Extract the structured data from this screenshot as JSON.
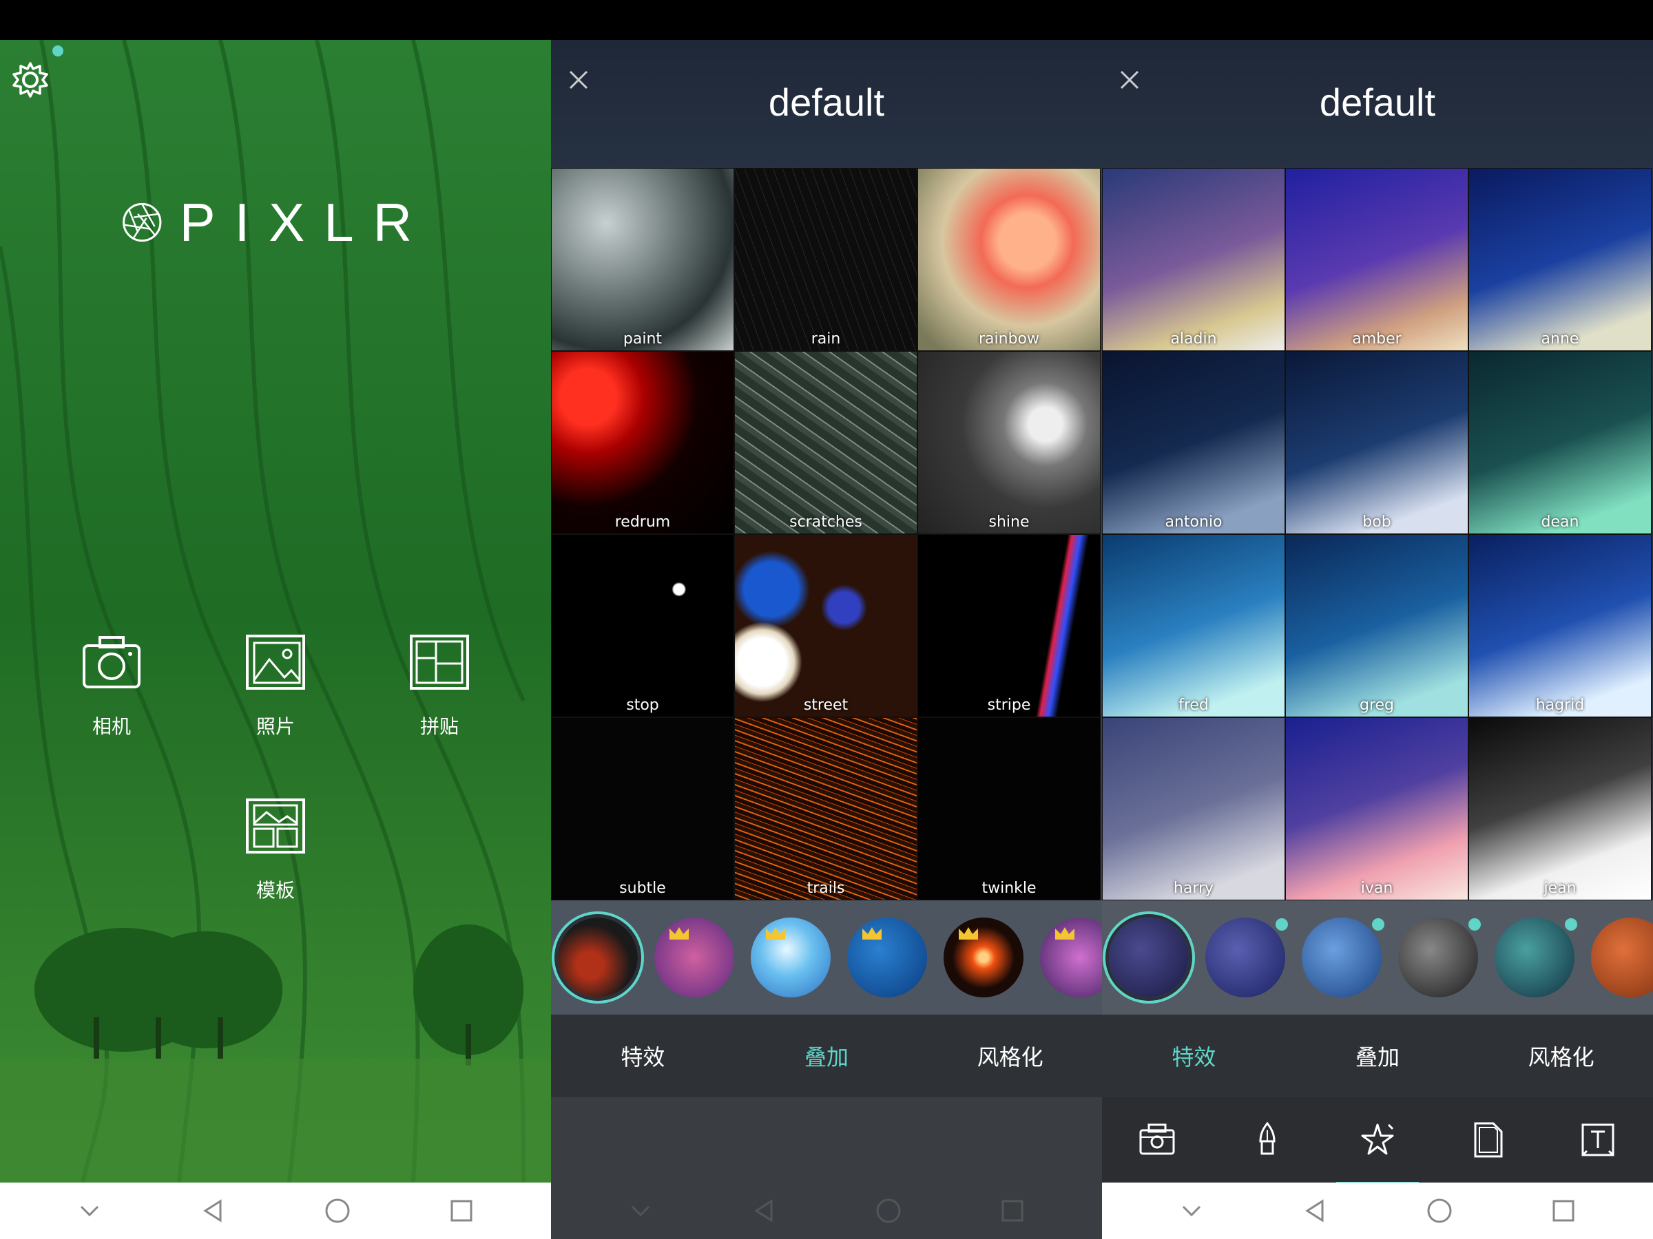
{
  "home": {
    "logo_text": "PIXLR",
    "buttons": [
      {
        "label": "相机",
        "icon": "camera-icon"
      },
      {
        "label": "照片",
        "icon": "photo-icon"
      },
      {
        "label": "拼贴",
        "icon": "collage-icon"
      },
      {
        "label": "模板",
        "icon": "template-icon"
      }
    ]
  },
  "overlay_screen": {
    "title": "default",
    "tiles": [
      "paint",
      "rain",
      "rainbow",
      "redrum",
      "scratches",
      "shine",
      "stop",
      "street",
      "stripe",
      "subtle",
      "trails",
      "twinkle"
    ],
    "tabs": [
      "特效",
      "叠加",
      "风格化"
    ],
    "active_tab": 1
  },
  "effect_screen": {
    "title": "default",
    "tiles": [
      "aladin",
      "amber",
      "anne",
      "antonio",
      "bob",
      "dean",
      "fred",
      "greg",
      "hagrid",
      "harry",
      "ivan",
      "jean"
    ],
    "tabs": [
      "特效",
      "叠加",
      "风格化"
    ],
    "active_tab": 0,
    "tools": [
      "camera-tool-icon",
      "brush-tool-icon",
      "effects-tool-icon",
      "overlay-tool-icon",
      "text-tool-icon"
    ]
  },
  "colors": {
    "accent": "#5fd5c8",
    "crown": "#f3c531"
  }
}
